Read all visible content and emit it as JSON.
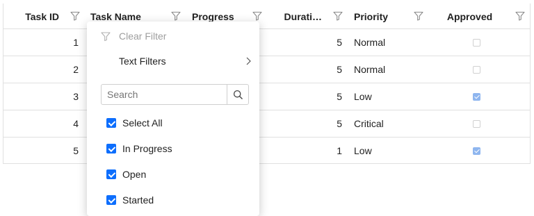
{
  "grid": {
    "columns": [
      {
        "key": "task_id",
        "label": "Task ID"
      },
      {
        "key": "task_name",
        "label": "Task Name"
      },
      {
        "key": "progress",
        "label": "Progress"
      },
      {
        "key": "duration",
        "label": "Durati…"
      },
      {
        "key": "priority",
        "label": "Priority"
      },
      {
        "key": "approved",
        "label": "Approved"
      }
    ],
    "rows": [
      {
        "task_id": "1",
        "duration": "5",
        "priority": "Normal",
        "approved": false
      },
      {
        "task_id": "2",
        "duration": "5",
        "priority": "Normal",
        "approved": false
      },
      {
        "task_id": "3",
        "duration": "5",
        "priority": "Low",
        "approved": true
      },
      {
        "task_id": "4",
        "duration": "5",
        "priority": "Critical",
        "approved": false
      },
      {
        "task_id": "5",
        "duration": "1",
        "priority": "Low",
        "approved": true
      }
    ]
  },
  "filter_popup": {
    "clear_filter_label": "Clear Filter",
    "text_filters_label": "Text Filters",
    "search_placeholder": "Search",
    "options": [
      {
        "label": "Select All",
        "checked": true
      },
      {
        "label": "In Progress",
        "checked": true
      },
      {
        "label": "Open",
        "checked": true
      },
      {
        "label": "Started",
        "checked": true
      }
    ]
  },
  "colors": {
    "accent": "#0d6efd",
    "approved_checked": "#8fb6ef",
    "border": "#e0e0e0",
    "icon": "#8a8a8a"
  },
  "icons": {
    "filter": "filter-icon",
    "chevron": "chevron-right-icon",
    "search": "search-icon"
  }
}
